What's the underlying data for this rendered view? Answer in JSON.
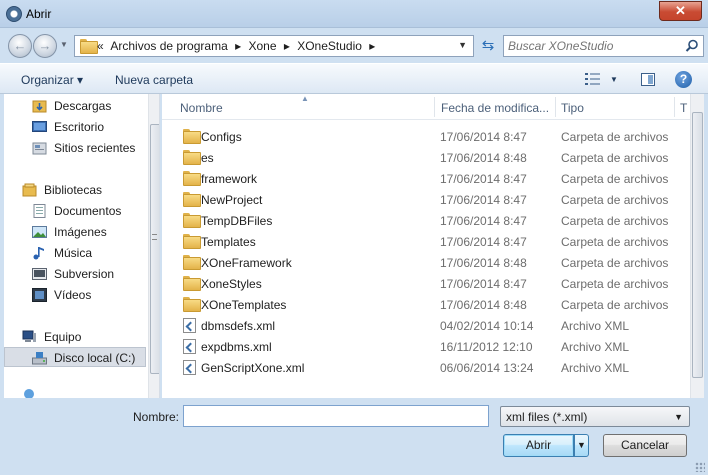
{
  "window": {
    "title": "Abrir",
    "close_label": "✕"
  },
  "address": {
    "chevron": "«",
    "crumbs": [
      "Archivos de programa",
      "Xone",
      "XOneStudio"
    ],
    "separator": "▸",
    "refresh_icon": "refresh-icon"
  },
  "search": {
    "placeholder": "Buscar XOneStudio"
  },
  "toolbar": {
    "organize_label": "Organizar ▾",
    "new_folder_label": "Nueva carpeta",
    "help_label": "?"
  },
  "sidebar": {
    "items": [
      {
        "label": "Descargas",
        "icon": "downloads-folder-icon"
      },
      {
        "label": "Escritorio",
        "icon": "desktop-icon"
      },
      {
        "label": "Sitios recientes",
        "icon": "recent-places-icon"
      },
      {
        "label": "Bibliotecas",
        "icon": "libraries-icon"
      },
      {
        "label": "Documentos",
        "icon": "documents-icon"
      },
      {
        "label": "Imágenes",
        "icon": "pictures-icon"
      },
      {
        "label": "Música",
        "icon": "music-icon"
      },
      {
        "label": "Subversion",
        "icon": "subversion-icon"
      },
      {
        "label": "Vídeos",
        "icon": "videos-icon"
      },
      {
        "label": "Equipo",
        "icon": "computer-icon"
      },
      {
        "label": "Disco local (C:)",
        "icon": "local-disk-icon"
      }
    ]
  },
  "columns": {
    "name": "Nombre",
    "date": "Fecha de modifica...",
    "type": "Tipo",
    "size": "T"
  },
  "files": [
    {
      "name": "Configs",
      "date": "17/06/2014 8:47",
      "type": "Carpeta de archivos",
      "kind": "folder"
    },
    {
      "name": "es",
      "date": "17/06/2014 8:48",
      "type": "Carpeta de archivos",
      "kind": "folder"
    },
    {
      "name": "framework",
      "date": "17/06/2014 8:47",
      "type": "Carpeta de archivos",
      "kind": "folder"
    },
    {
      "name": "NewProject",
      "date": "17/06/2014 8:47",
      "type": "Carpeta de archivos",
      "kind": "folder"
    },
    {
      "name": "TempDBFiles",
      "date": "17/06/2014 8:47",
      "type": "Carpeta de archivos",
      "kind": "folder"
    },
    {
      "name": "Templates",
      "date": "17/06/2014 8:47",
      "type": "Carpeta de archivos",
      "kind": "folder"
    },
    {
      "name": "XOneFramework",
      "date": "17/06/2014 8:48",
      "type": "Carpeta de archivos",
      "kind": "folder"
    },
    {
      "name": "XoneStyles",
      "date": "17/06/2014 8:47",
      "type": "Carpeta de archivos",
      "kind": "folder"
    },
    {
      "name": "XOneTemplates",
      "date": "17/06/2014 8:48",
      "type": "Carpeta de archivos",
      "kind": "folder"
    },
    {
      "name": "dbmsdefs.xml",
      "date": "04/02/2014 10:14",
      "type": "Archivo XML",
      "kind": "xml"
    },
    {
      "name": "expdbms.xml",
      "date": "16/11/2012 12:10",
      "type": "Archivo XML",
      "kind": "xml"
    },
    {
      "name": "GenScriptXone.xml",
      "date": "06/06/2014 13:24",
      "type": "Archivo XML",
      "kind": "xml"
    }
  ],
  "footer": {
    "filename_label": "Nombre:",
    "filename_value": "",
    "filetype_value": "xml files (*.xml)",
    "open_label": "Abrir",
    "cancel_label": "Cancelar"
  },
  "colors": {
    "accent": "#3c7fb1",
    "frame": "#cfe0f1",
    "close": "#c94b33"
  }
}
